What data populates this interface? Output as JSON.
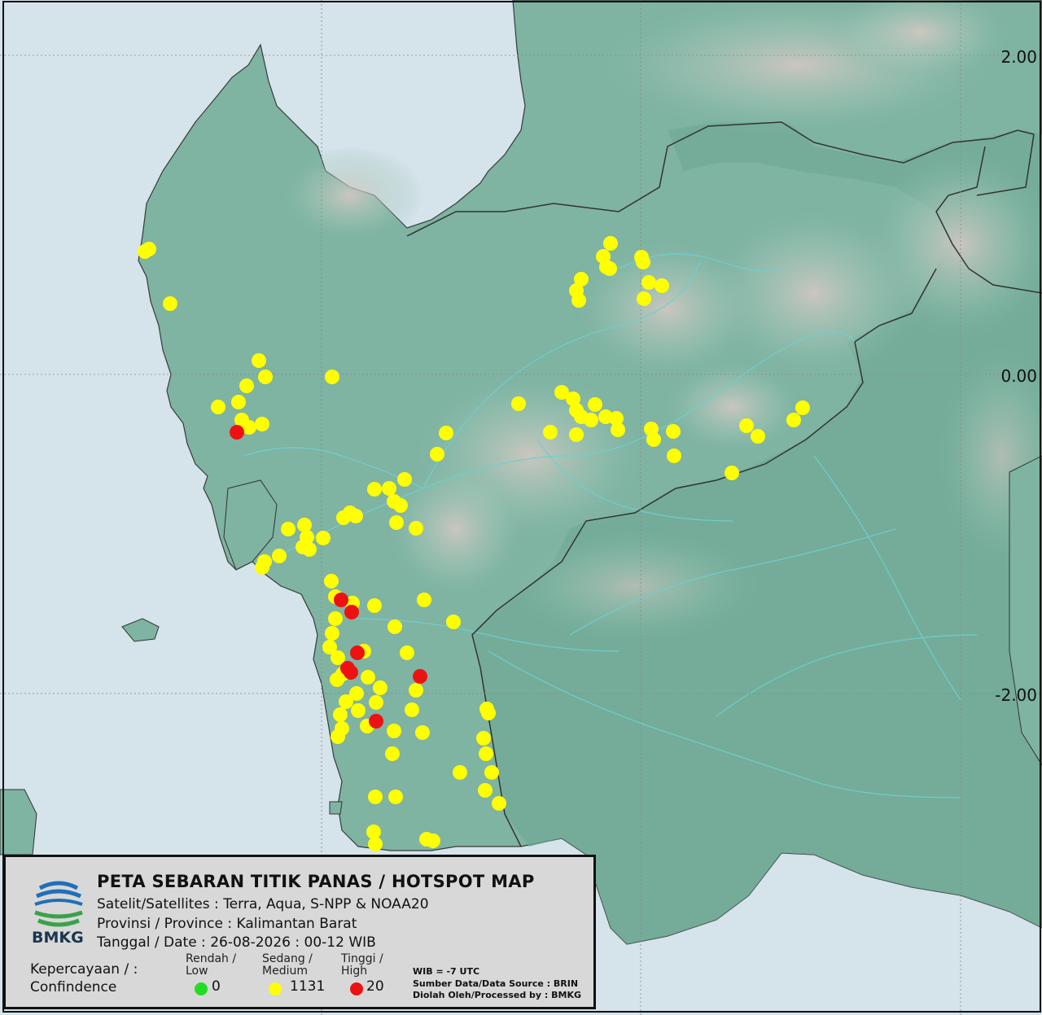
{
  "map": {
    "lat_labels": [
      "2.00",
      "0.00",
      "-2.00"
    ],
    "colors": {
      "sea": "#d5e3ea",
      "land": "#7fb3a2",
      "land_dark": "#5e9c88",
      "border": "#3a3a3a",
      "river": "#6ed0d0",
      "low": "#22dd22",
      "medium": "#ffff00",
      "high": "#ee1111"
    },
    "hotspots_medium": [
      [
        183,
        306
      ],
      [
        178,
        309
      ],
      [
        209,
        373
      ],
      [
        318,
        443
      ],
      [
        326,
        463
      ],
      [
        303,
        474
      ],
      [
        293,
        494
      ],
      [
        268,
        500
      ],
      [
        297,
        516
      ],
      [
        322,
        521
      ],
      [
        306,
        525
      ],
      [
        408,
        463
      ],
      [
        637,
        496
      ],
      [
        690,
        482
      ],
      [
        704,
        490
      ],
      [
        708,
        504
      ],
      [
        714,
        512
      ],
      [
        726,
        516
      ],
      [
        731,
        497
      ],
      [
        744,
        512
      ],
      [
        757,
        514
      ],
      [
        759,
        528
      ],
      [
        676,
        531
      ],
      [
        708,
        534
      ],
      [
        800,
        527
      ],
      [
        803,
        540
      ],
      [
        827,
        530
      ],
      [
        828,
        560
      ],
      [
        917,
        523
      ],
      [
        931,
        536
      ],
      [
        975,
        516
      ],
      [
        986,
        501
      ],
      [
        899,
        581
      ],
      [
        548,
        532
      ],
      [
        537,
        558
      ],
      [
        750,
        299
      ],
      [
        741,
        315
      ],
      [
        745,
        328
      ],
      [
        749,
        330
      ],
      [
        788,
        316
      ],
      [
        790,
        322
      ],
      [
        714,
        343
      ],
      [
        708,
        357
      ],
      [
        711,
        369
      ],
      [
        797,
        347
      ],
      [
        813,
        351
      ],
      [
        791,
        367
      ],
      [
        460,
        601
      ],
      [
        478,
        600
      ],
      [
        497,
        589
      ],
      [
        484,
        616
      ],
      [
        492,
        621
      ],
      [
        430,
        630
      ],
      [
        422,
        636
      ],
      [
        437,
        634
      ],
      [
        487,
        642
      ],
      [
        511,
        649
      ],
      [
        354,
        650
      ],
      [
        374,
        645
      ],
      [
        377,
        660
      ],
      [
        397,
        661
      ],
      [
        372,
        672
      ],
      [
        380,
        675
      ],
      [
        343,
        683
      ],
      [
        325,
        690
      ],
      [
        322,
        697
      ],
      [
        407,
        714
      ],
      [
        412,
        733
      ],
      [
        433,
        741
      ],
      [
        460,
        744
      ],
      [
        521,
        737
      ],
      [
        557,
        764
      ],
      [
        485,
        770
      ],
      [
        412,
        760
      ],
      [
        408,
        778
      ],
      [
        405,
        795
      ],
      [
        415,
        808
      ],
      [
        421,
        828
      ],
      [
        414,
        835
      ],
      [
        447,
        800
      ],
      [
        452,
        832
      ],
      [
        467,
        845
      ],
      [
        438,
        852
      ],
      [
        425,
        862
      ],
      [
        418,
        878
      ],
      [
        420,
        895
      ],
      [
        415,
        905
      ],
      [
        440,
        873
      ],
      [
        451,
        892
      ],
      [
        462,
        863
      ],
      [
        484,
        898
      ],
      [
        500,
        802
      ],
      [
        511,
        848
      ],
      [
        506,
        872
      ],
      [
        519,
        900
      ],
      [
        482,
        926
      ],
      [
        598,
        871
      ],
      [
        600,
        876
      ],
      [
        594,
        907
      ],
      [
        597,
        926
      ],
      [
        565,
        949
      ],
      [
        604,
        949
      ],
      [
        596,
        971
      ],
      [
        613,
        987
      ],
      [
        461,
        979
      ],
      [
        486,
        979
      ],
      [
        459,
        1022
      ],
      [
        461,
        1037
      ],
      [
        524,
        1031
      ],
      [
        532,
        1033
      ]
    ],
    "hotspots_high": [
      [
        291,
        531
      ],
      [
        419,
        737
      ],
      [
        432,
        752
      ],
      [
        439,
        802
      ],
      [
        427,
        821
      ],
      [
        431,
        826
      ],
      [
        516,
        831
      ],
      [
        462,
        886
      ]
    ]
  },
  "legend": {
    "title": "PETA SEBARAN TITIK PANAS / HOTSPOT MAP",
    "satellites": "Satelit/Satellites : Terra, Aqua, S-NPP & NOAA20",
    "province": "Provinsi / Province : Kalimantan Barat",
    "date": "Tanggal / Date : 26-08-2026 : 00-12 WIB",
    "logo_text": "BMKG",
    "confidence_label_1": "Kepercayaan / :",
    "confidence_label_2": "Confindence",
    "low_label_1": "Rendah /",
    "low_label_2": "Low",
    "low_count": "0",
    "medium_label_1": "Sedang /",
    "medium_label_2": "Medium",
    "medium_count": "1131",
    "high_label_1": "Tinggi /",
    "high_label_2": "High",
    "high_count": "20",
    "timezone": "WIB = -7 UTC",
    "source": "Sumber Data/Data Source : BRIN",
    "processed": "Diolah Oleh/Processed by  : BMKG"
  }
}
